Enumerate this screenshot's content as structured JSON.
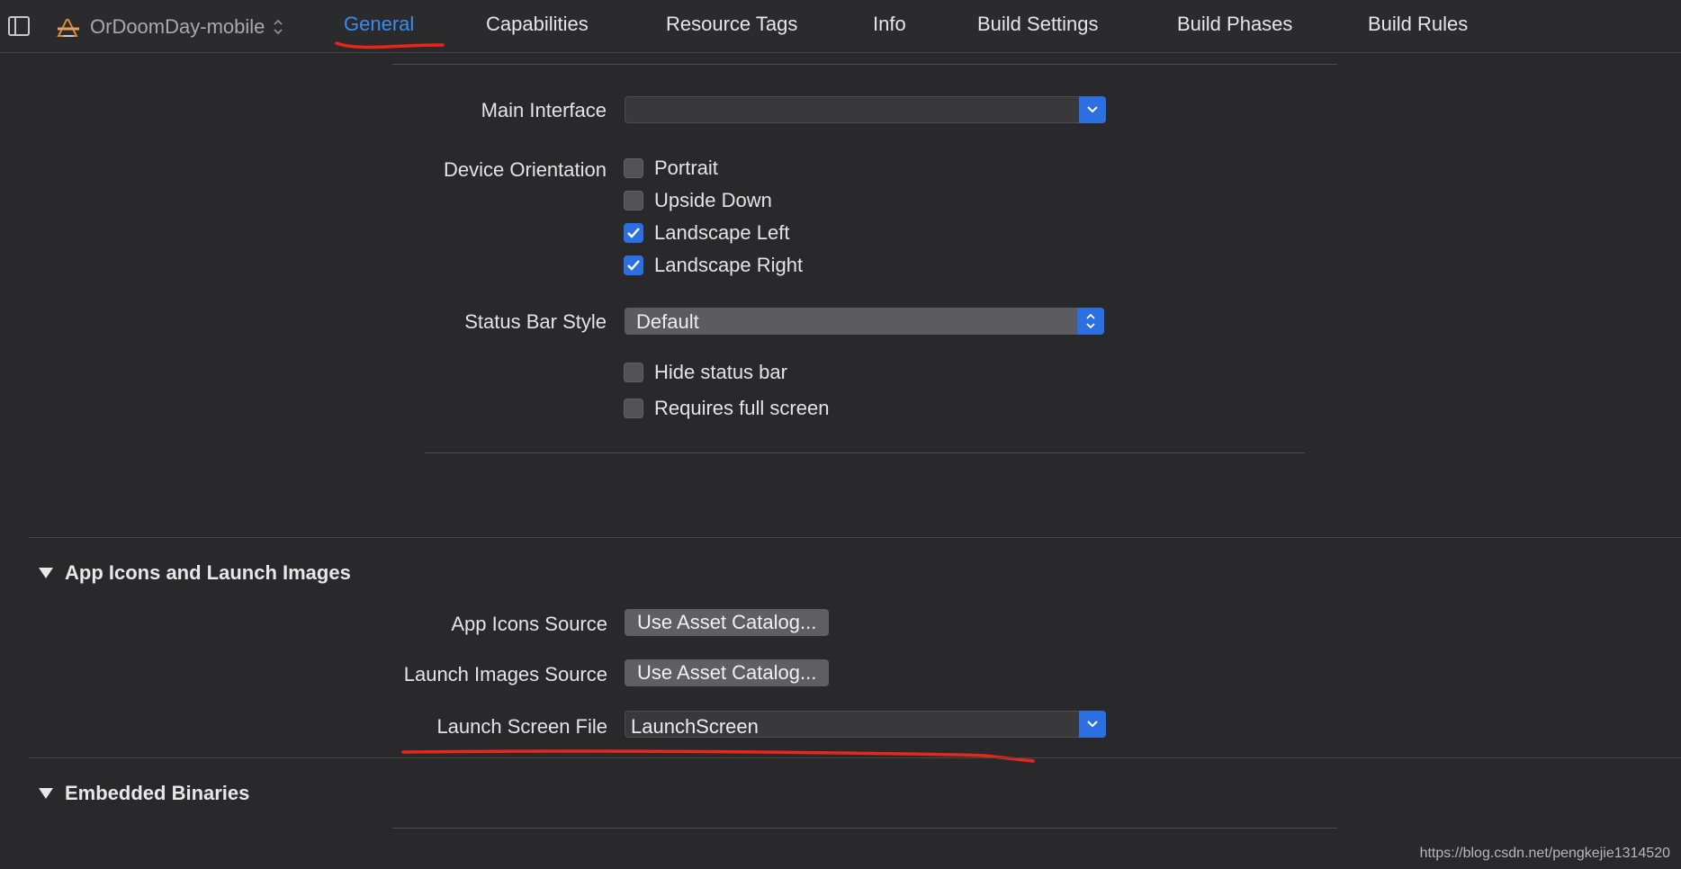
{
  "header": {
    "project": "OrDoomDay-mobile",
    "tabs": [
      {
        "label": "General",
        "active": true
      },
      {
        "label": "Capabilities"
      },
      {
        "label": "Resource Tags"
      },
      {
        "label": "Info"
      },
      {
        "label": "Build Settings"
      },
      {
        "label": "Build Phases"
      },
      {
        "label": "Build Rules"
      }
    ]
  },
  "deployment": {
    "main_interface_label": "Main Interface",
    "main_interface_value": "",
    "device_orientation_label": "Device Orientation",
    "orientations": [
      {
        "label": "Portrait",
        "checked": false
      },
      {
        "label": "Upside Down",
        "checked": false
      },
      {
        "label": "Landscape Left",
        "checked": true
      },
      {
        "label": "Landscape Right",
        "checked": true
      }
    ],
    "status_bar_style_label": "Status Bar Style",
    "status_bar_style_value": "Default",
    "hide_status_bar": {
      "label": "Hide status bar",
      "checked": false
    },
    "requires_full_screen": {
      "label": "Requires full screen",
      "checked": false
    }
  },
  "app_icons": {
    "section_title": "App Icons and Launch Images",
    "app_icons_source_label": "App Icons Source",
    "app_icons_source_button": "Use Asset Catalog...",
    "launch_images_source_label": "Launch Images Source",
    "launch_images_source_button": "Use Asset Catalog...",
    "launch_screen_file_label": "Launch Screen File",
    "launch_screen_file_value": "LaunchScreen"
  },
  "embedded": {
    "section_title": "Embedded Binaries"
  },
  "watermark": "https://blog.csdn.net/pengkejie1314520",
  "colors": {
    "accent": "#2c6fe0",
    "active_tab": "#3b8cf0",
    "annotation": "#e8261c",
    "background": "#29292b"
  }
}
